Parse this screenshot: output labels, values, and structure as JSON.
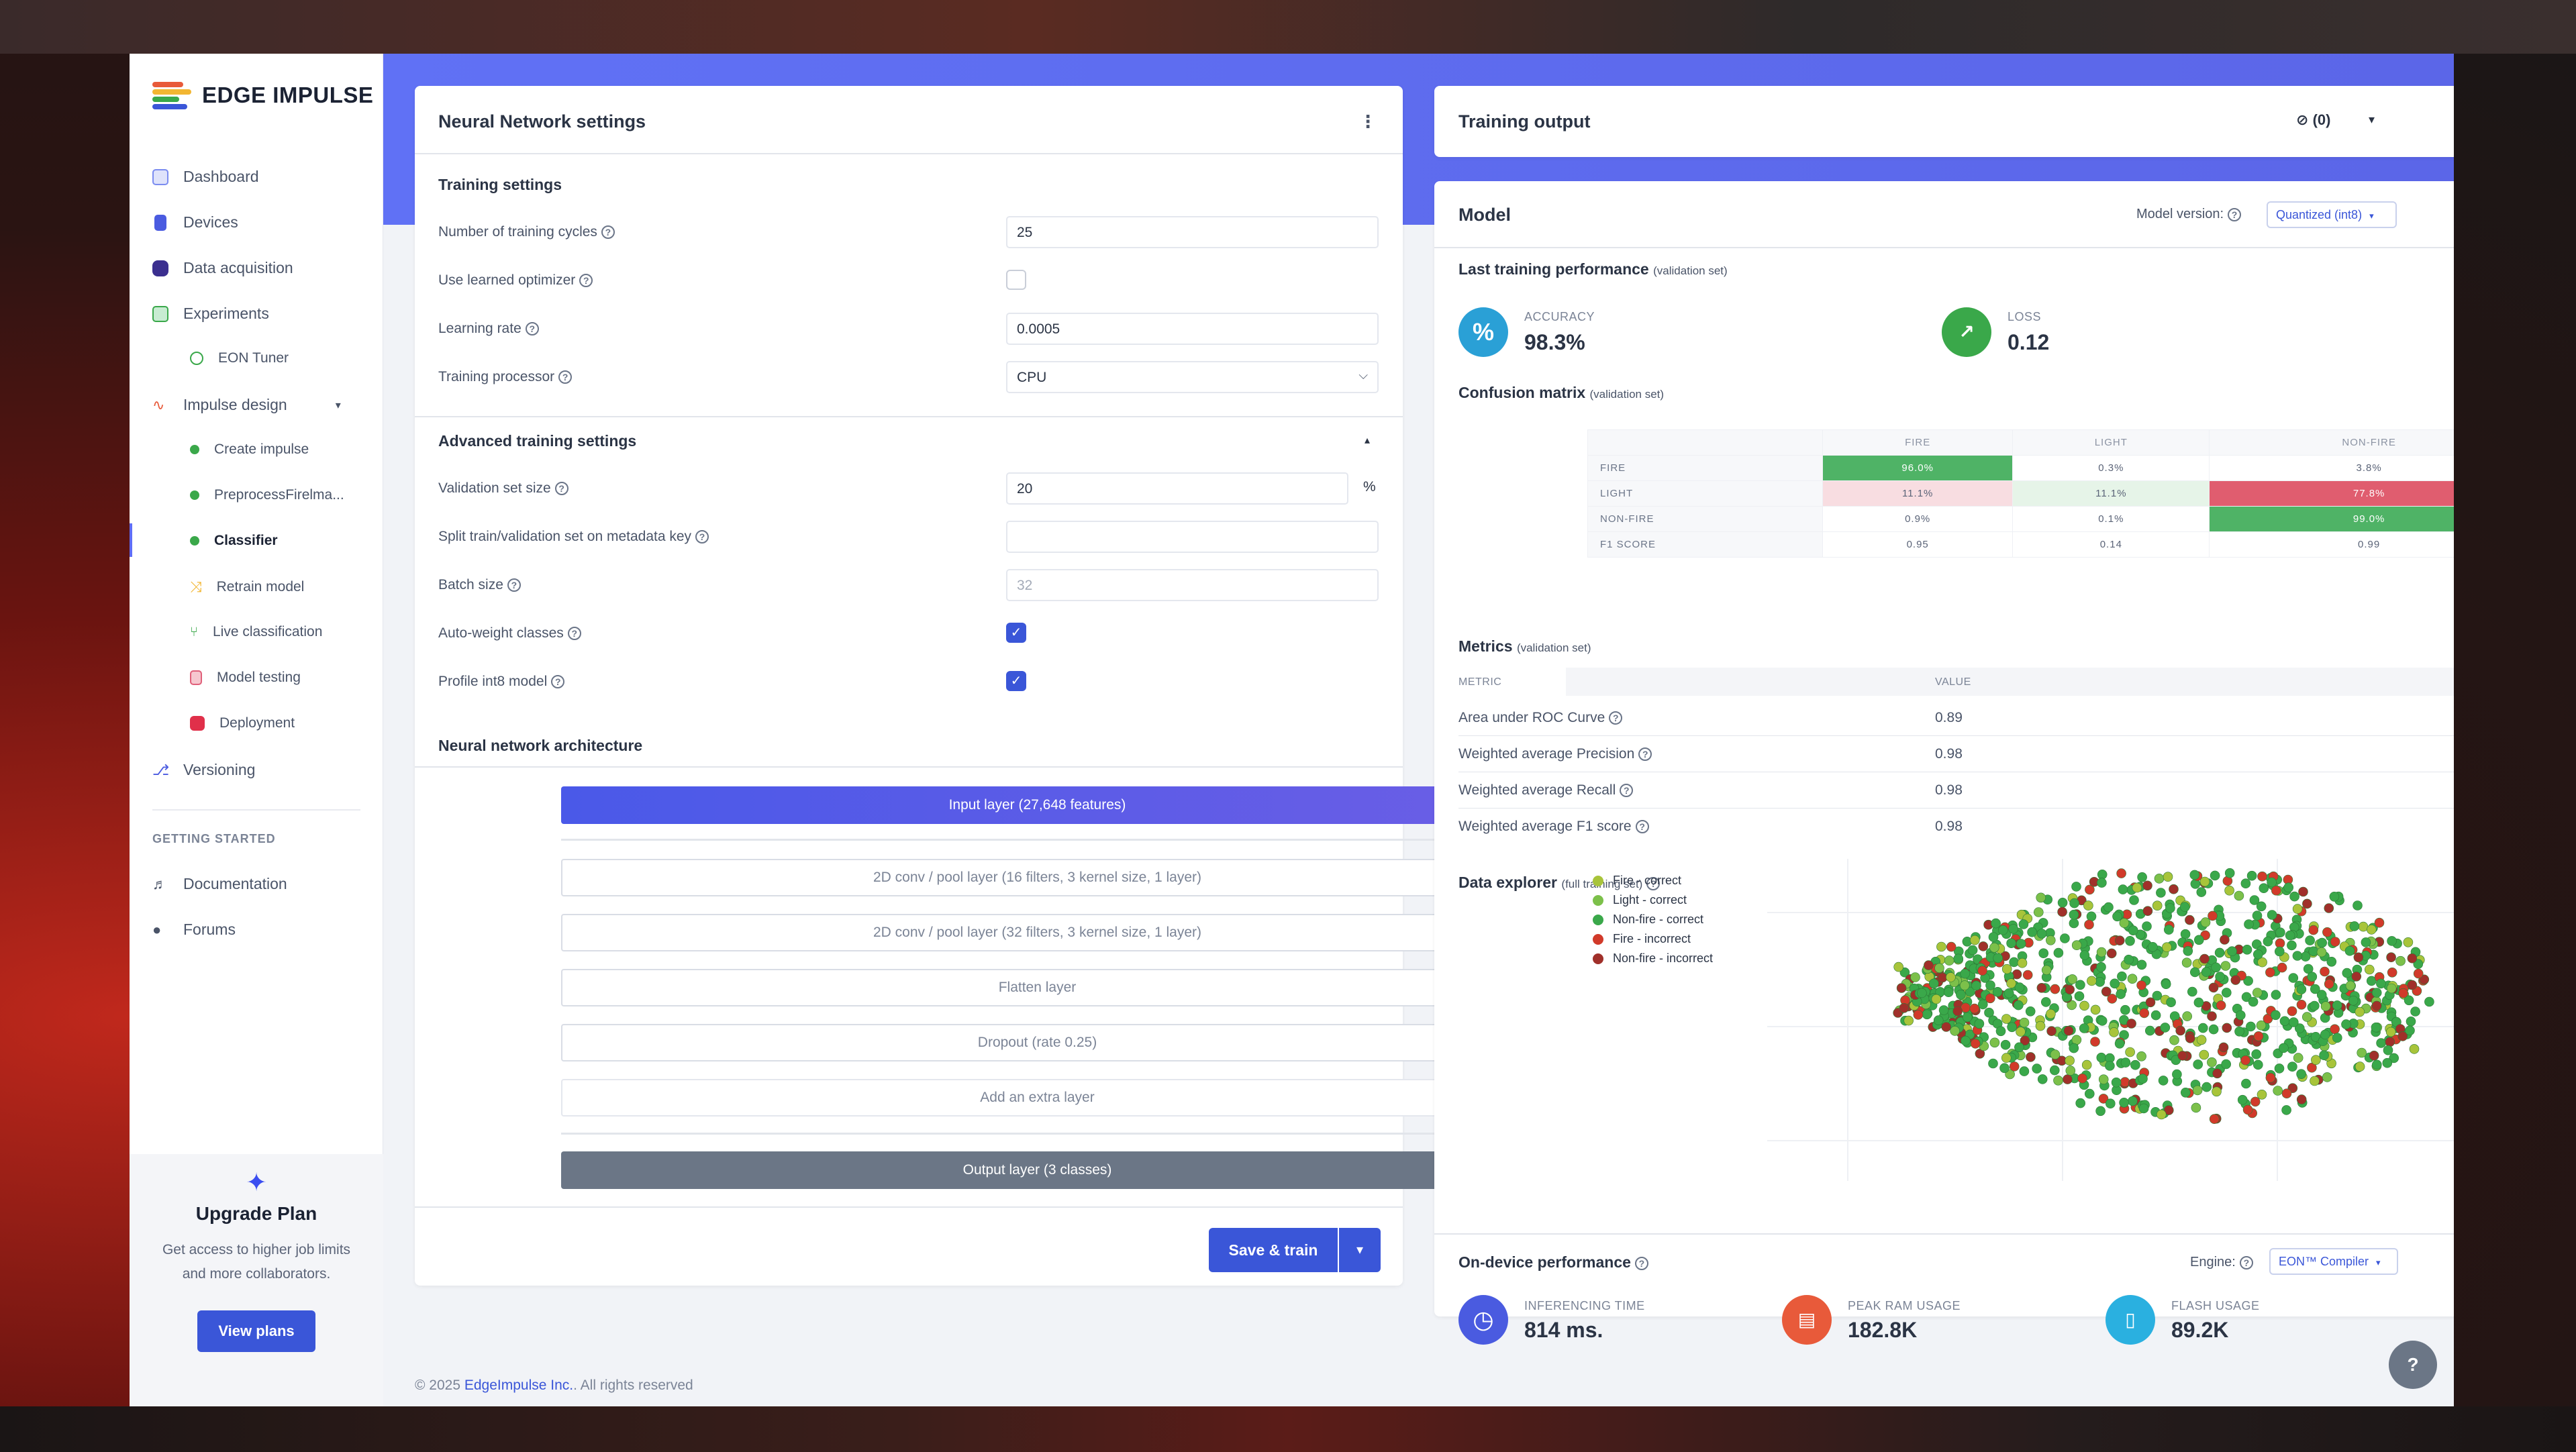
{
  "brand": {
    "name": "EDGE IMPULSE"
  },
  "sidebar": {
    "items": [
      {
        "label": "Dashboard"
      },
      {
        "label": "Devices"
      },
      {
        "label": "Data acquisition"
      },
      {
        "label": "Experiments"
      },
      {
        "label": "EON Tuner"
      },
      {
        "label": "Impulse design"
      },
      {
        "label": "Create impulse"
      },
      {
        "label": "PreprocessFirelma..."
      },
      {
        "label": "Classifier"
      },
      {
        "label": "Retrain model"
      },
      {
        "label": "Live classification"
      },
      {
        "label": "Model testing"
      },
      {
        "label": "Deployment"
      },
      {
        "label": "Versioning"
      }
    ],
    "getting_started_heading": "GETTING STARTED",
    "getting_started": [
      {
        "label": "Documentation"
      },
      {
        "label": "Forums"
      }
    ],
    "upgrade": {
      "title": "Upgrade Plan",
      "text": "Get access to higher job limits and more collaborators.",
      "button": "View plans"
    }
  },
  "nn": {
    "title": "Neural Network settings",
    "training_settings": "Training settings",
    "cycles_label": "Number of training cycles",
    "cycles_value": "25",
    "learned_opt_label": "Use learned optimizer",
    "lr_label": "Learning rate",
    "lr_value": "0.0005",
    "processor_label": "Training processor",
    "processor_value": "CPU",
    "advanced": "Advanced training settings",
    "val_size_label": "Validation set size",
    "val_size_value": "20",
    "val_size_unit": "%",
    "split_label": "Split train/validation set on metadata key",
    "batch_label": "Batch size",
    "batch_value": "32",
    "autoweight_label": "Auto-weight classes",
    "profile_label": "Profile int8 model",
    "arch_title": "Neural network architecture",
    "layers": [
      "Input layer (27,648 features)",
      "2D conv / pool layer (16 filters, 3 kernel size, 1 layer)",
      "2D conv / pool layer (32 filters, 3 kernel size, 1 layer)",
      "Flatten layer",
      "Dropout (rate 0.25)",
      "Add an extra layer",
      "Output layer (3 classes)"
    ],
    "save_train": "Save & train"
  },
  "training_output": {
    "title": "Training output",
    "notif": "(0)"
  },
  "model": {
    "title": "Model",
    "version_label": "Model version:",
    "version_value": "Quantized (int8)",
    "last_perf": "Last training performance",
    "last_perf_sub": "(validation set)",
    "accuracy_label": "ACCURACY",
    "accuracy_value": "98.3%",
    "loss_label": "LOSS",
    "loss_value": "0.12",
    "cm_title": "Confusion matrix",
    "cm_sub": "(validation set)",
    "cm_cols": [
      "FIRE",
      "LIGHT",
      "NON-FIRE"
    ],
    "cm_rows": [
      {
        "label": "FIRE",
        "cells": [
          "96.0%",
          "0.3%",
          "3.8%"
        ]
      },
      {
        "label": "LIGHT",
        "cells": [
          "11.1%",
          "11.1%",
          "77.8%"
        ]
      },
      {
        "label": "NON-FIRE",
        "cells": [
          "0.9%",
          "0.1%",
          "99.0%"
        ]
      },
      {
        "label": "F1 SCORE",
        "cells": [
          "0.95",
          "0.14",
          "0.99"
        ]
      }
    ],
    "metrics_title": "Metrics",
    "metrics_sub": "(validation set)",
    "metrics_head_metric": "METRIC",
    "metrics_head_value": "VALUE",
    "metrics": [
      {
        "name": "Area under ROC Curve",
        "value": "0.89"
      },
      {
        "name": "Weighted average Precision",
        "value": "0.98"
      },
      {
        "name": "Weighted average Recall",
        "value": "0.98"
      },
      {
        "name": "Weighted average F1 score",
        "value": "0.98"
      }
    ],
    "explorer_title": "Data explorer",
    "explorer_sub": "(full training set)",
    "legend": [
      {
        "label": "Fire - correct",
        "color": "#a8c43a"
      },
      {
        "label": "Light - correct",
        "color": "#7cc04a"
      },
      {
        "label": "Non-fire - correct",
        "color": "#3aa84a"
      },
      {
        "label": "Fire - incorrect",
        "color": "#d13a2a"
      },
      {
        "label": "Non-fire - incorrect",
        "color": "#a0302a"
      }
    ],
    "ondevice_title": "On-device performance",
    "engine_label": "Engine:",
    "engine_value": "EON™ Compiler",
    "inference_label": "INFERENCING TIME",
    "inference_value": "814 ms.",
    "ram_label": "PEAK RAM USAGE",
    "ram_value": "182.8K",
    "flash_label": "FLASH USAGE",
    "flash_value": "89.2K"
  },
  "footer": {
    "prefix": "© 2025",
    "company": "EdgeImpulse Inc.",
    "suffix": "All rights reserved"
  }
}
